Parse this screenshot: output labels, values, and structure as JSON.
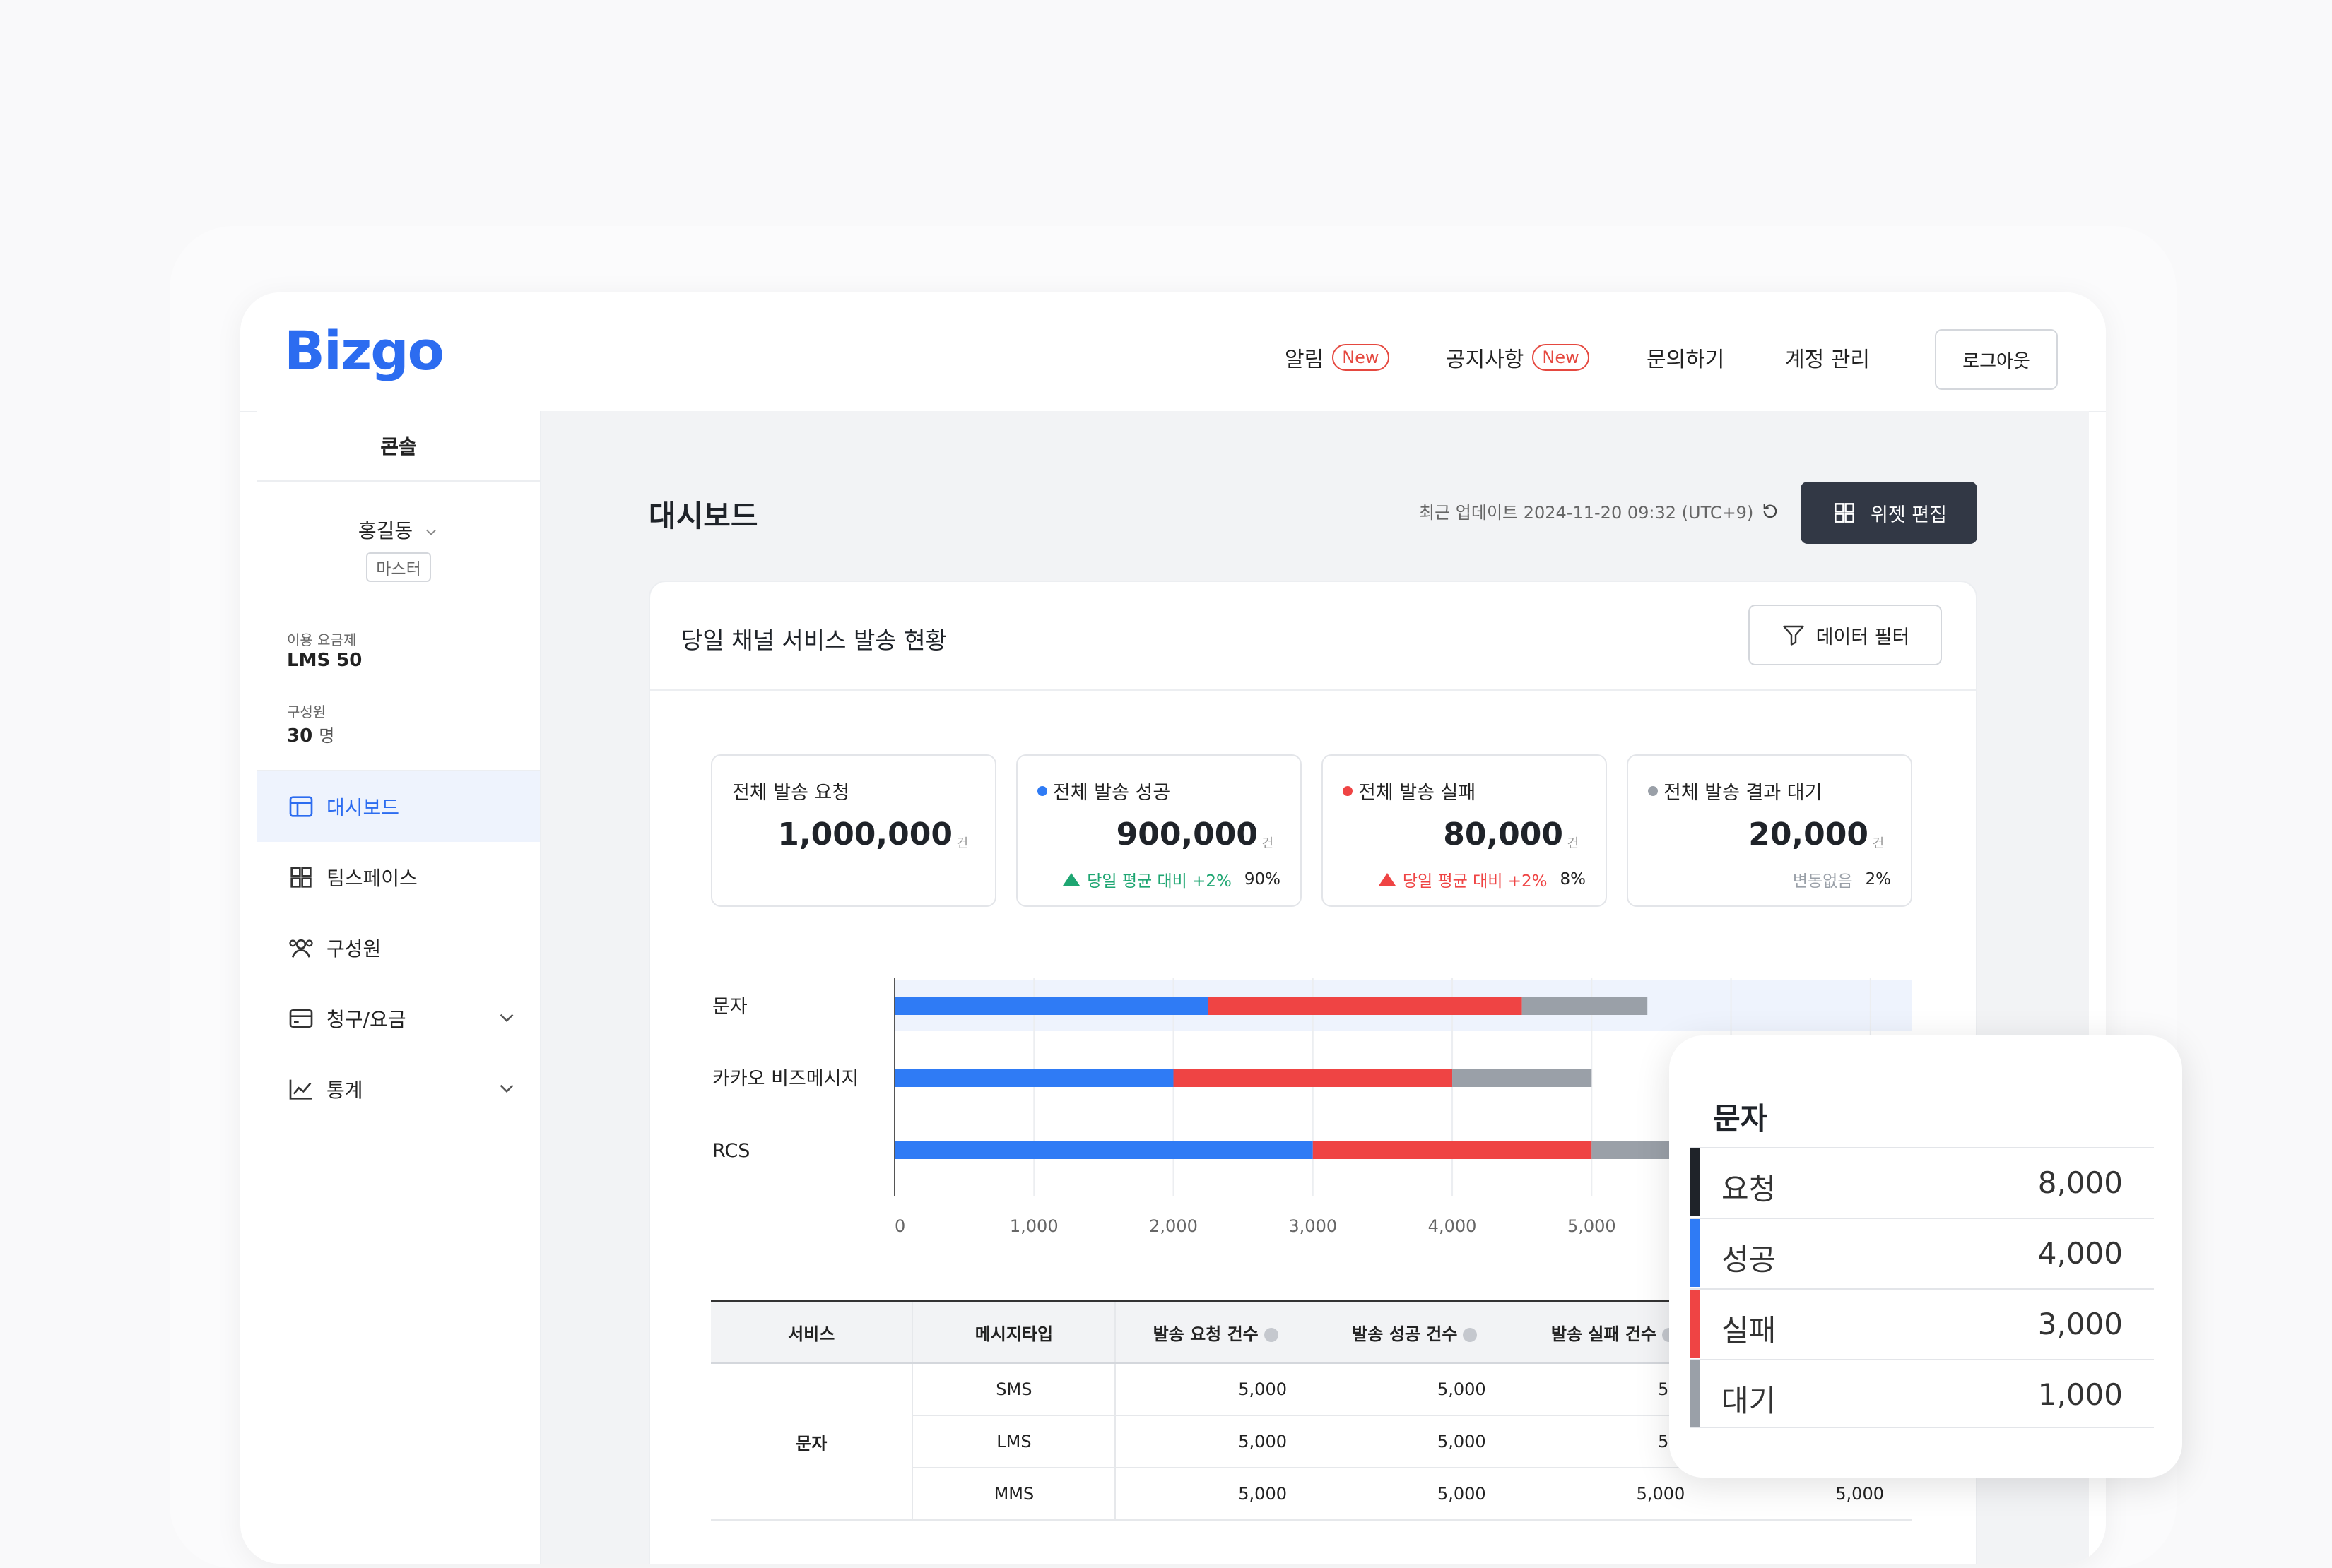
{
  "header": {
    "logo": "Bizgo",
    "nav": [
      {
        "label": "알림",
        "badge": "New"
      },
      {
        "label": "공지사항",
        "badge": "New"
      },
      {
        "label": "문의하기"
      },
      {
        "label": "계정 관리"
      }
    ],
    "logout_label": "로그아웃"
  },
  "sidebar": {
    "title": "콘솔",
    "user_name": "홍길동",
    "user_role": "마스터",
    "plan_label": "이용 요금제",
    "plan_value": "LMS 50",
    "members_label": "구성원",
    "members_value": "30",
    "members_unit": "명",
    "menu": [
      {
        "label": "대시보드",
        "icon": "layout-icon",
        "active": true
      },
      {
        "label": "팀스페이스",
        "icon": "grid-icon"
      },
      {
        "label": "구성원",
        "icon": "users-icon"
      },
      {
        "label": "청구/요금",
        "icon": "card-icon",
        "expandable": true
      },
      {
        "label": "통계",
        "icon": "chart-line-icon",
        "expandable": true
      }
    ]
  },
  "main": {
    "title": "대시보드",
    "update_text": "최근 업데이트 2024-11-20 09:32 (UTC+9)",
    "widget_edit_label": "위젯 편집",
    "panel_title": "당일 채널 서비스 발송 현황",
    "filter_label": "데이터 필터",
    "kpis": [
      {
        "label": "전체 발송 요청",
        "value": "1,000,000",
        "unit": "건",
        "dot": ""
      },
      {
        "label": "전체 발송 성공",
        "value": "900,000",
        "unit": "건",
        "dot": "#2f7bf5",
        "trend": "당일 평균 대비 +2%",
        "trend_color": "#1ea672",
        "pct": "90%"
      },
      {
        "label": "전체 발송 실패",
        "value": "80,000",
        "unit": "건",
        "dot": "#ef4444",
        "trend": "당일 평균 대비 +2%",
        "trend_color": "#ef4444",
        "pct": "8%"
      },
      {
        "label": "전체 발송 결과 대기",
        "value": "20,000",
        "unit": "건",
        "dot": "#9aa0a8",
        "trend": "변동없음",
        "trend_color": "#9aa0a8",
        "pct": "2%"
      }
    ],
    "table": {
      "headers": [
        "서비스",
        "메시지타입",
        "발송 요청 건수",
        "발송 성공 건수",
        "발송 실패 건수",
        ""
      ],
      "group": "문자",
      "rows": [
        {
          "type": "SMS",
          "req": "5,000",
          "succ": "5,000",
          "fail": "5,0",
          "wait": ""
        },
        {
          "type": "LMS",
          "req": "5,000",
          "succ": "5,000",
          "fail": "5,0",
          "wait": ""
        },
        {
          "type": "MMS",
          "req": "5,000",
          "succ": "5,000",
          "fail": "5,000",
          "wait": "5,000"
        }
      ]
    }
  },
  "chart_data": {
    "type": "bar",
    "orientation": "horizontal",
    "stacked": true,
    "categories": [
      "문자",
      "카카오 비즈메시지",
      "RCS"
    ],
    "series": [
      {
        "values": [
          2250,
          2000,
          3000
        ],
        "color": "#2f7bf5"
      },
      {
        "values": [
          2250,
          2000,
          2000
        ],
        "color": "#ef4444"
      },
      {
        "values": [
          900,
          1000,
          600
        ],
        "color": "#9aa0a8"
      }
    ],
    "x_ticks": [
      "0",
      "1,000",
      "2,000",
      "3,000",
      "4,000",
      "5,000"
    ],
    "xlim": [
      0,
      7300
    ],
    "highlighted_category": "문자"
  },
  "tooltip": {
    "title": "문자",
    "rows": [
      {
        "label": "요청",
        "value": "8,000",
        "color": "#1f2329"
      },
      {
        "label": "성공",
        "value": "4,000",
        "color": "#2f7bf5"
      },
      {
        "label": "실패",
        "value": "3,000",
        "color": "#ef4444"
      },
      {
        "label": "대기",
        "value": "1,000",
        "color": "#9aa0a8"
      }
    ]
  }
}
